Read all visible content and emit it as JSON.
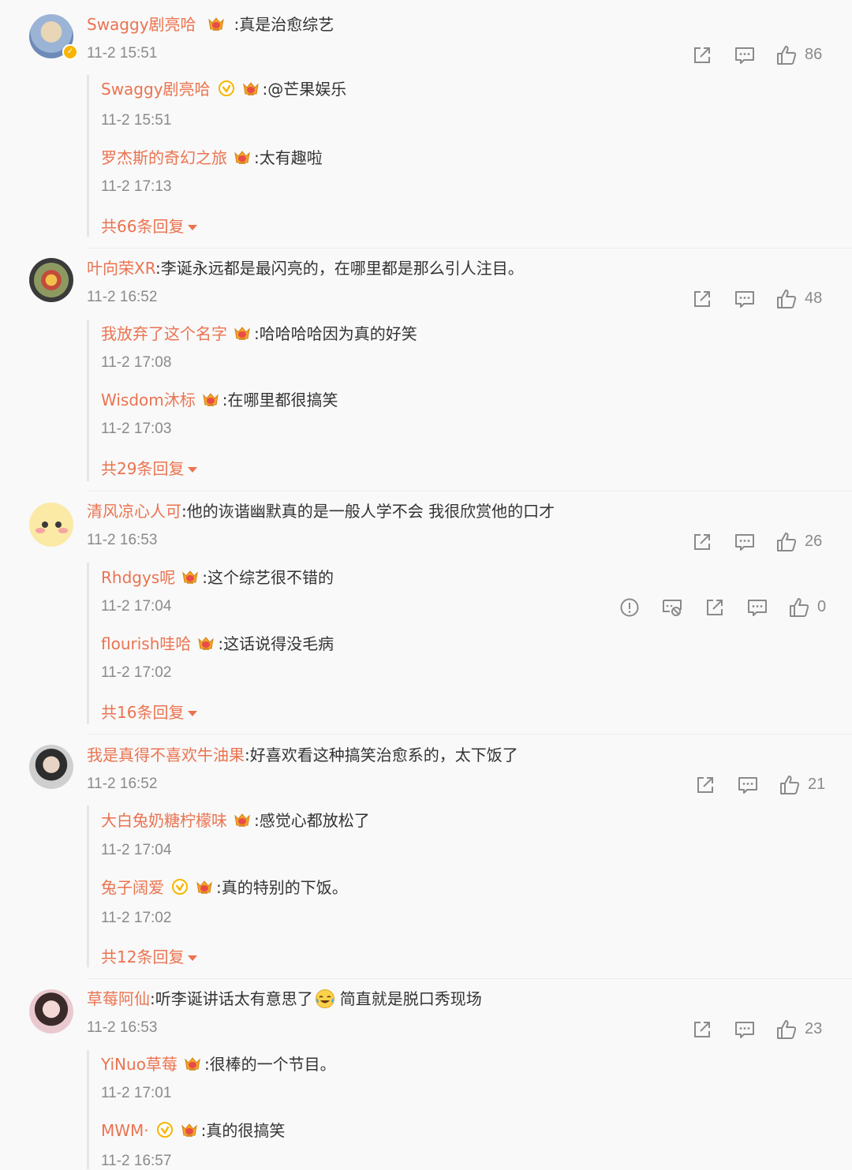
{
  "comments": [
    {
      "user": "Swaggy剧亮哈",
      "text": ":真是治愈综艺",
      "time": "11-2 15:51",
      "likes": "86",
      "replies": [
        {
          "user": "Swaggy剧亮哈",
          "text": ":@芒果娱乐",
          "time": "11-2 15:51"
        },
        {
          "user": "罗杰斯的奇幻之旅",
          "text": ":太有趣啦",
          "time": "11-2 17:13"
        }
      ],
      "more": "共66条回复"
    },
    {
      "user": "叶向荣XR",
      "text": ":李诞永远都是最闪亮的，在哪里都是那么引人注目。",
      "time": "11-2 16:52",
      "likes": "48",
      "replies": [
        {
          "user": "我放弃了这个名字",
          "text": ":哈哈哈哈因为真的好笑",
          "time": "11-2 17:08"
        },
        {
          "user": "Wisdom沐标",
          "text": ":在哪里都很搞笑",
          "time": "11-2 17:03"
        }
      ],
      "more": "共29条回复"
    },
    {
      "user": "清风凉心人可",
      "text": ":他的诙谐幽默真的是一般人学不会 我很欣赏他的口才",
      "time": "11-2 16:53",
      "likes": "26",
      "replies": [
        {
          "user": "Rhdgys呢",
          "text": ":这个综艺很不错的",
          "time": "11-2 17:04",
          "likes": "0"
        },
        {
          "user": "flourish哇哈",
          "text": ":这话说得没毛病",
          "time": "11-2 17:02"
        }
      ],
      "more": "共16条回复"
    },
    {
      "user": "我是真得不喜欢牛油果",
      "text": ":好喜欢看这种搞笑治愈系的，太下饭了",
      "time": "11-2 16:52",
      "likes": "21",
      "replies": [
        {
          "user": "大白兔奶糖柠檬味",
          "text": ":感觉心都放松了",
          "time": "11-2 17:04"
        },
        {
          "user": "兔子阔爱",
          "text": ":真的特别的下饭。",
          "time": "11-2 17:02"
        }
      ],
      "more": "共12条回复"
    },
    {
      "user": "草莓阿仙",
      "text": ":听李诞讲话太有意思了",
      "text2": "简直就是脱口秀现场",
      "time": "11-2 16:53",
      "likes": "23",
      "replies": [
        {
          "user": "YiNuo草莓",
          "text": ":很棒的一个节目。",
          "time": "11-2 17:01"
        },
        {
          "user": "MWM·",
          "text": ":真的很搞笑",
          "time": "11-2 16:57"
        }
      ]
    }
  ],
  "icons": [
    "share-icon",
    "comment-icon",
    "like-icon",
    "report-icon",
    "block-icon",
    "crown-badge-icon",
    "verified-icon",
    "laugh-cry-emoji"
  ],
  "colors": {
    "username": "#eb7350",
    "time": "#8a8a8a",
    "verified": "#f7b500",
    "text": "#333333"
  }
}
